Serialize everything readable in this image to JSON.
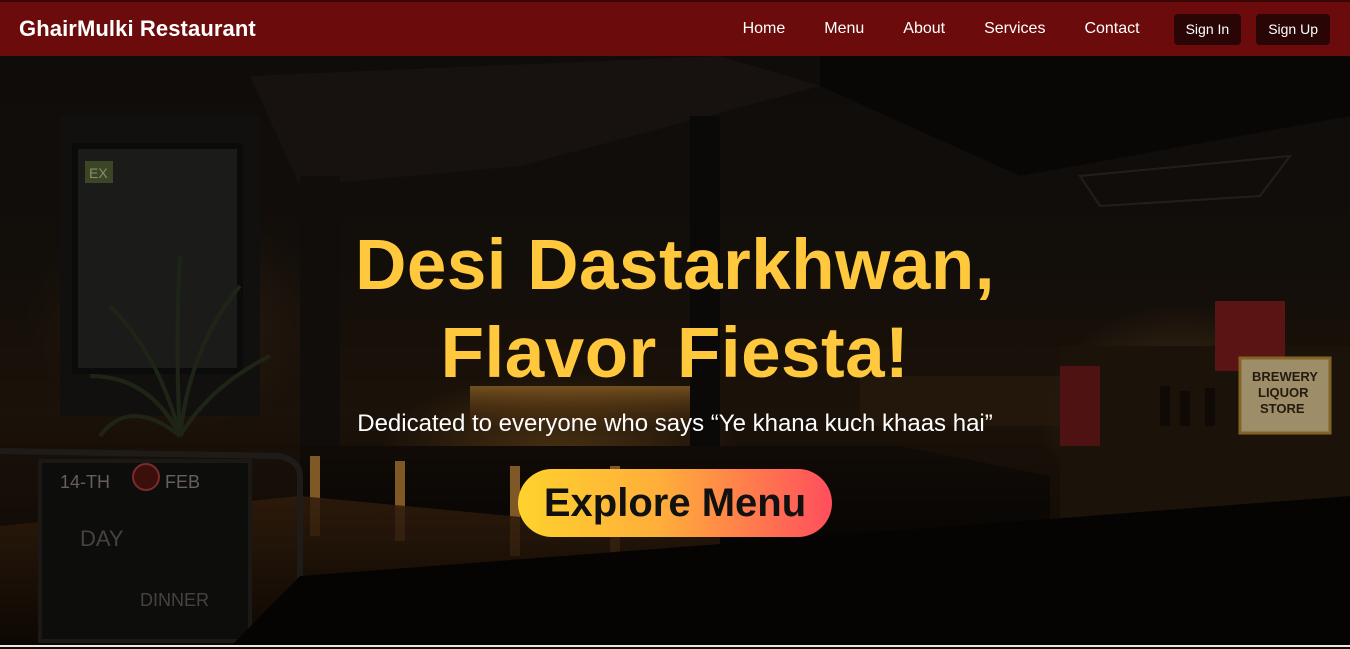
{
  "navbar": {
    "brand": "GhairMulki Restaurant",
    "links": [
      "Home",
      "Menu",
      "About",
      "Services",
      "Contact"
    ],
    "sign_in": "Sign In",
    "sign_up": "Sign Up"
  },
  "hero": {
    "headline_line1": "Desi Dastarkhwan,",
    "headline_line2": "Flavor Fiesta!",
    "tagline": "Dedicated to everyone who says “Ye khana kuch khaas hai”",
    "cta": "Explore Menu",
    "background_scene": {
      "sign_exit": "EX",
      "chalkboard_text": [
        "14-TH",
        "FEB",
        "DAY",
        "DINNER"
      ],
      "store_sign": [
        "BREWERY",
        "LIQUOR",
        "STORE"
      ]
    }
  },
  "colors": {
    "navbar_bg": "#6b0b0b",
    "headline": "#ffc83d",
    "cta_gradient_start": "#ffd22e",
    "cta_gradient_end": "#ff4e5d"
  }
}
